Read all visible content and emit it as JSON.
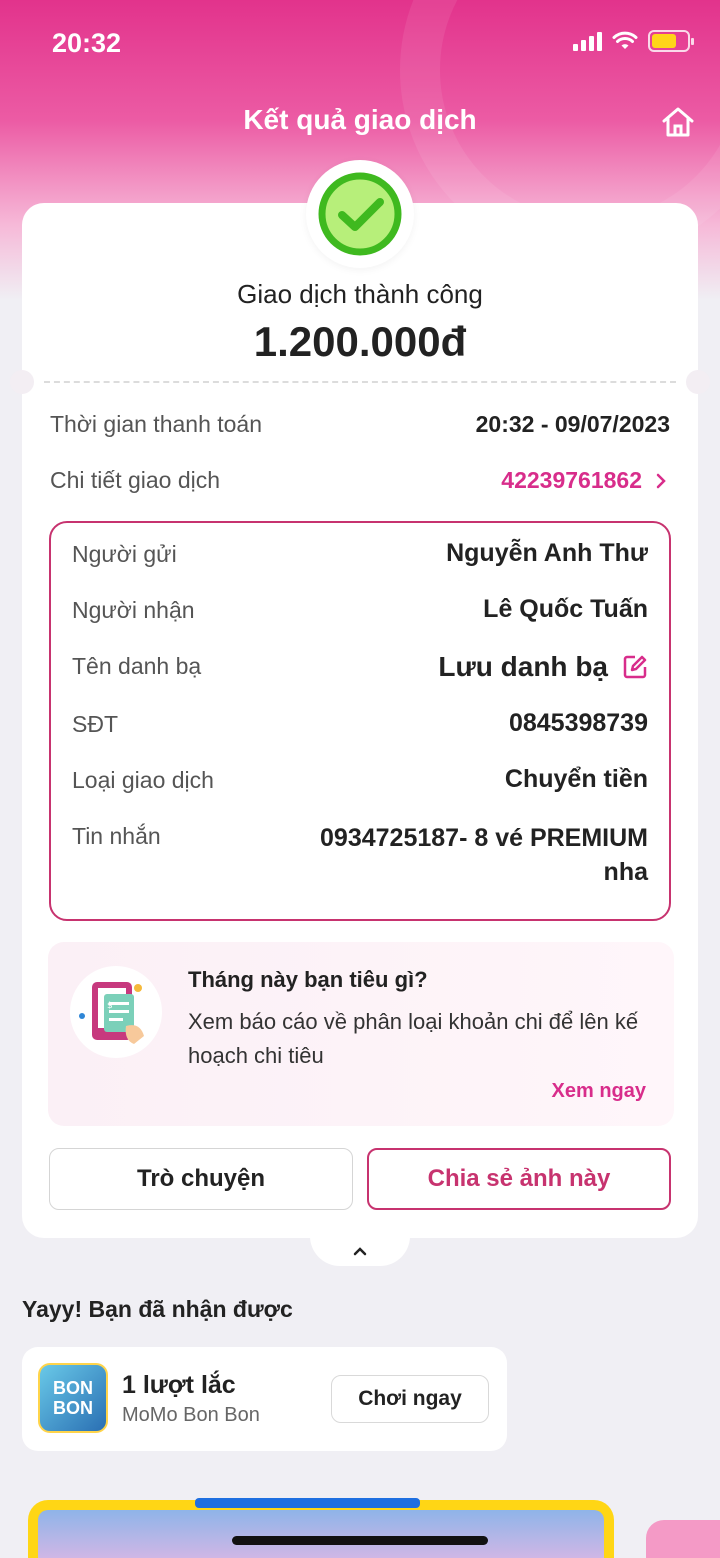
{
  "status_bar": {
    "time": "20:32"
  },
  "header": {
    "title": "Kết quả giao dịch"
  },
  "result": {
    "status": "Giao dịch thành công",
    "amount": "1.200.000đ"
  },
  "summary": {
    "time_label": "Thời gian thanh toán",
    "time_value": "20:32 - 09/07/2023",
    "detail_label": "Chi tiết giao dịch",
    "detail_value": "42239761862"
  },
  "details": [
    {
      "label": "Người gửi",
      "value": "Nguyễn Anh Thư"
    },
    {
      "label": "Người nhận",
      "value": "Lê Quốc Tuấn"
    },
    {
      "label": "Tên danh bạ",
      "value": "Lưu danh bạ"
    },
    {
      "label": "SĐT",
      "value": "0845398739"
    },
    {
      "label": "Loại giao dịch",
      "value": "Chuyển tiền"
    },
    {
      "label": "Tin nhắn",
      "value_line1": "0934725187- 8 vé PREMIUM",
      "value_line2": "nha"
    }
  ],
  "promo": {
    "title": "Tháng này bạn tiêu gì?",
    "desc": "Xem báo cáo về phân loại khoản chi để lên kế hoạch chi tiêu",
    "link": "Xem ngay"
  },
  "actions": {
    "chat": "Trò chuyện",
    "share": "Chia sẻ ảnh này"
  },
  "rewards": {
    "title": "Yayy! Bạn đã nhận được",
    "item_title": "1 lượt lắc",
    "item_sub": "MoMo Bon Bon",
    "item_button": "Chơi ngay",
    "icon_text1": "BON",
    "icon_text2": "BON"
  },
  "colors": {
    "brand": "#d82d8b",
    "border": "#c7336f",
    "success": "#3fb91f"
  }
}
